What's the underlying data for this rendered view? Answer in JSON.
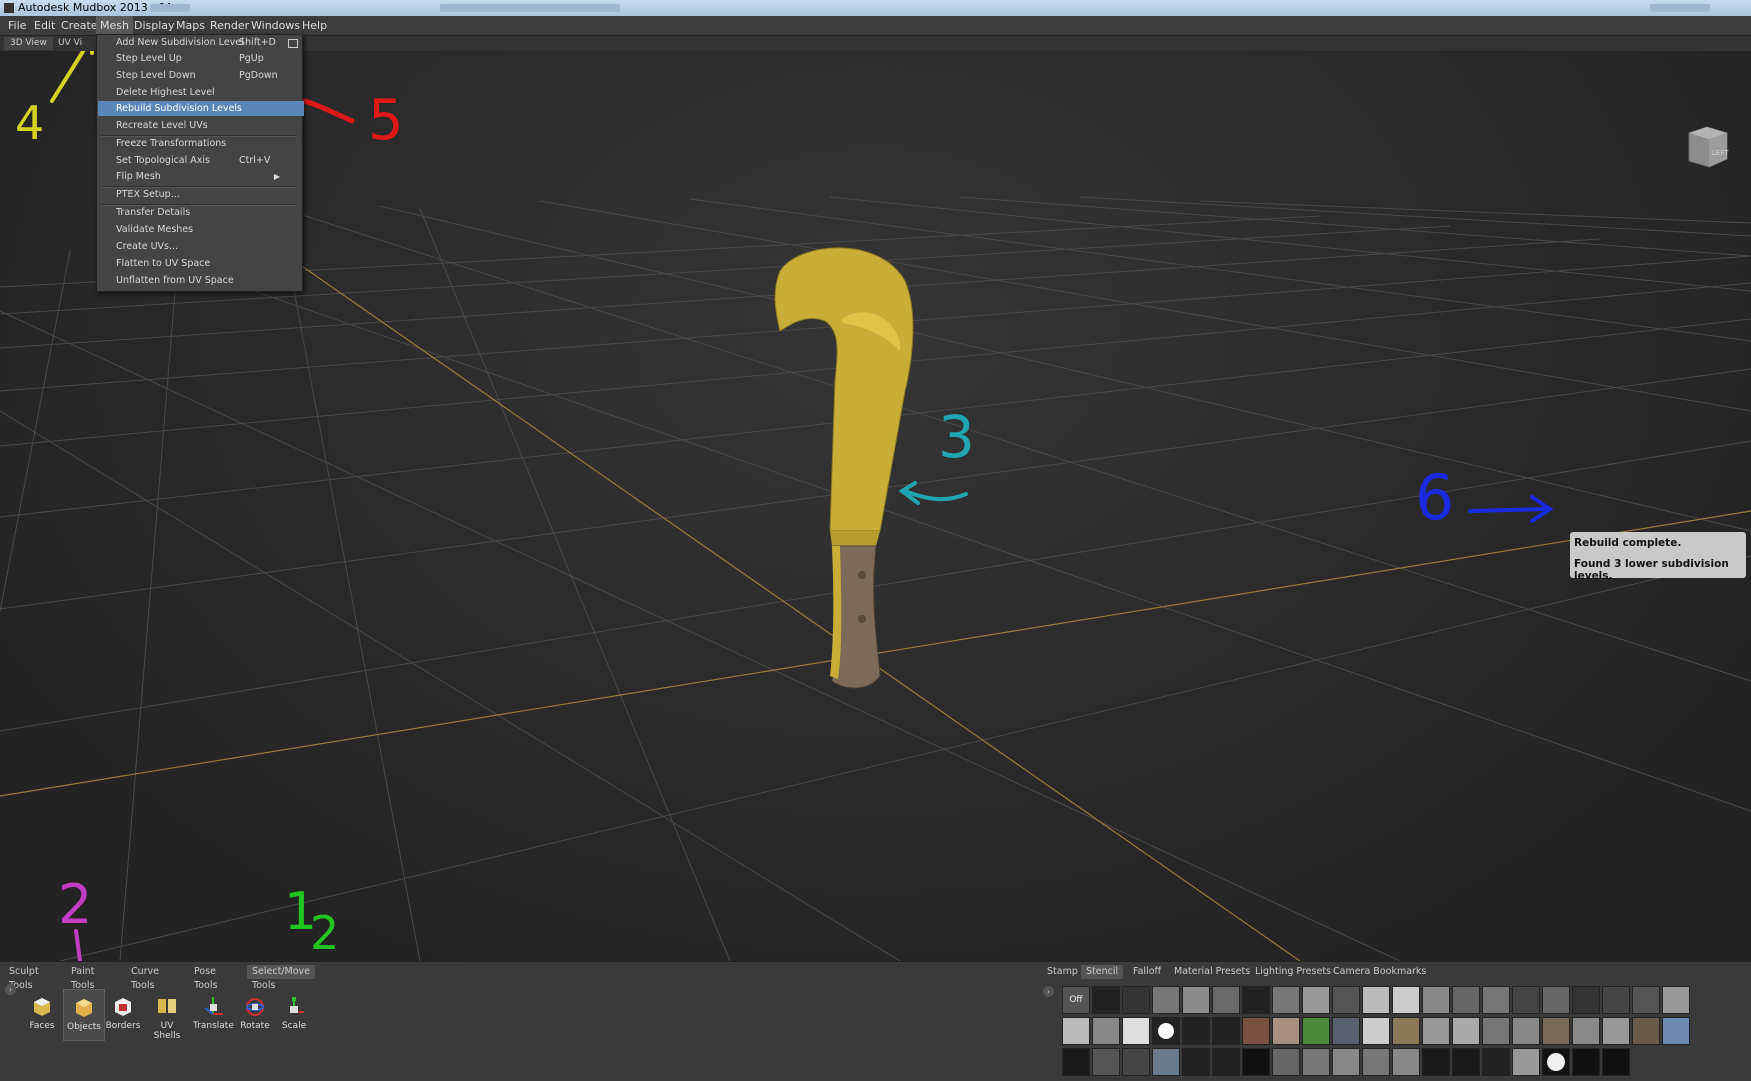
{
  "window": {
    "title": "Autodesk Mudbox 2013 x64"
  },
  "menubar": [
    {
      "label": "File"
    },
    {
      "label": "Edit"
    },
    {
      "label": "Create"
    },
    {
      "label": "Mesh"
    },
    {
      "label": "Display"
    },
    {
      "label": "Maps"
    },
    {
      "label": "Render"
    },
    {
      "label": "Windows"
    },
    {
      "label": "Help"
    }
  ],
  "view_tabs": [
    {
      "label": "3D View"
    },
    {
      "label": "UV Vi"
    }
  ],
  "mesh_menu": {
    "items": [
      {
        "label": "Add New Subdivision Level",
        "shortcut": "Shift+D"
      },
      {
        "label": "Step Level Up",
        "shortcut": "PgUp"
      },
      {
        "label": "Step Level Down",
        "shortcut": "PgDown"
      },
      {
        "label": "Delete Highest Level",
        "shortcut": ""
      },
      {
        "label": "Rebuild Subdivision Levels",
        "shortcut": ""
      },
      {
        "label": "Recreate Level UVs",
        "shortcut": ""
      },
      {
        "label": "Freeze Transformations",
        "shortcut": ""
      },
      {
        "label": "Set Topological Axis",
        "shortcut": "Ctrl+V"
      },
      {
        "label": "Flip Mesh",
        "shortcut": ""
      },
      {
        "label": "PTEX Setup...",
        "shortcut": ""
      },
      {
        "label": "Transfer Details",
        "shortcut": ""
      },
      {
        "label": "Validate Meshes",
        "shortcut": ""
      },
      {
        "label": "Create UVs...",
        "shortcut": ""
      },
      {
        "label": "Flatten to UV Space",
        "shortcut": ""
      },
      {
        "label": "Unflatten from UV Space",
        "shortcut": ""
      }
    ]
  },
  "viewcube": {
    "face": "LEFT"
  },
  "notification": {
    "line1": "Rebuild complete.",
    "line2": "Found 3 lower subdivision levels."
  },
  "annotations": [
    {
      "text": "4",
      "color": "#d4d21e"
    },
    {
      "text": "5",
      "color": "#e01818"
    },
    {
      "text": "3",
      "color": "#1fa6b0"
    },
    {
      "text": "6",
      "color": "#1a2ae0"
    },
    {
      "text": "2",
      "color": "#c23dc4"
    },
    {
      "text": "1",
      "color": "#22c41f"
    },
    {
      "text": "2",
      "color": "#22c41f"
    }
  ],
  "tool_tabs": [
    {
      "label": "Sculpt Tools"
    },
    {
      "label": "Paint Tools"
    },
    {
      "label": "Curve Tools"
    },
    {
      "label": "Pose Tools"
    },
    {
      "label": "Select/Move Tools"
    }
  ],
  "tools": [
    {
      "label": "Faces",
      "icon": "faces-icon"
    },
    {
      "label": "Objects",
      "icon": "objects-icon"
    },
    {
      "label": "Borders",
      "icon": "borders-icon"
    },
    {
      "label": "UV Shells",
      "icon": "uv-shells-icon"
    },
    {
      "label": "Translate",
      "icon": "translate-icon"
    },
    {
      "label": "Rotate",
      "icon": "rotate-icon"
    },
    {
      "label": "Scale",
      "icon": "scale-icon"
    }
  ],
  "tray_tabs": [
    {
      "label": "Stamp"
    },
    {
      "label": "Stencil"
    },
    {
      "label": "Falloff"
    },
    {
      "label": "Material Presets"
    },
    {
      "label": "Lighting Presets"
    },
    {
      "label": "Camera Bookmarks"
    }
  ],
  "stencil_off": "Off",
  "colors": {
    "blade": "#cdb23a",
    "handle": "#7d6a58",
    "highlight": "#5b87b8",
    "ground_axis": "#9a7a3c"
  }
}
